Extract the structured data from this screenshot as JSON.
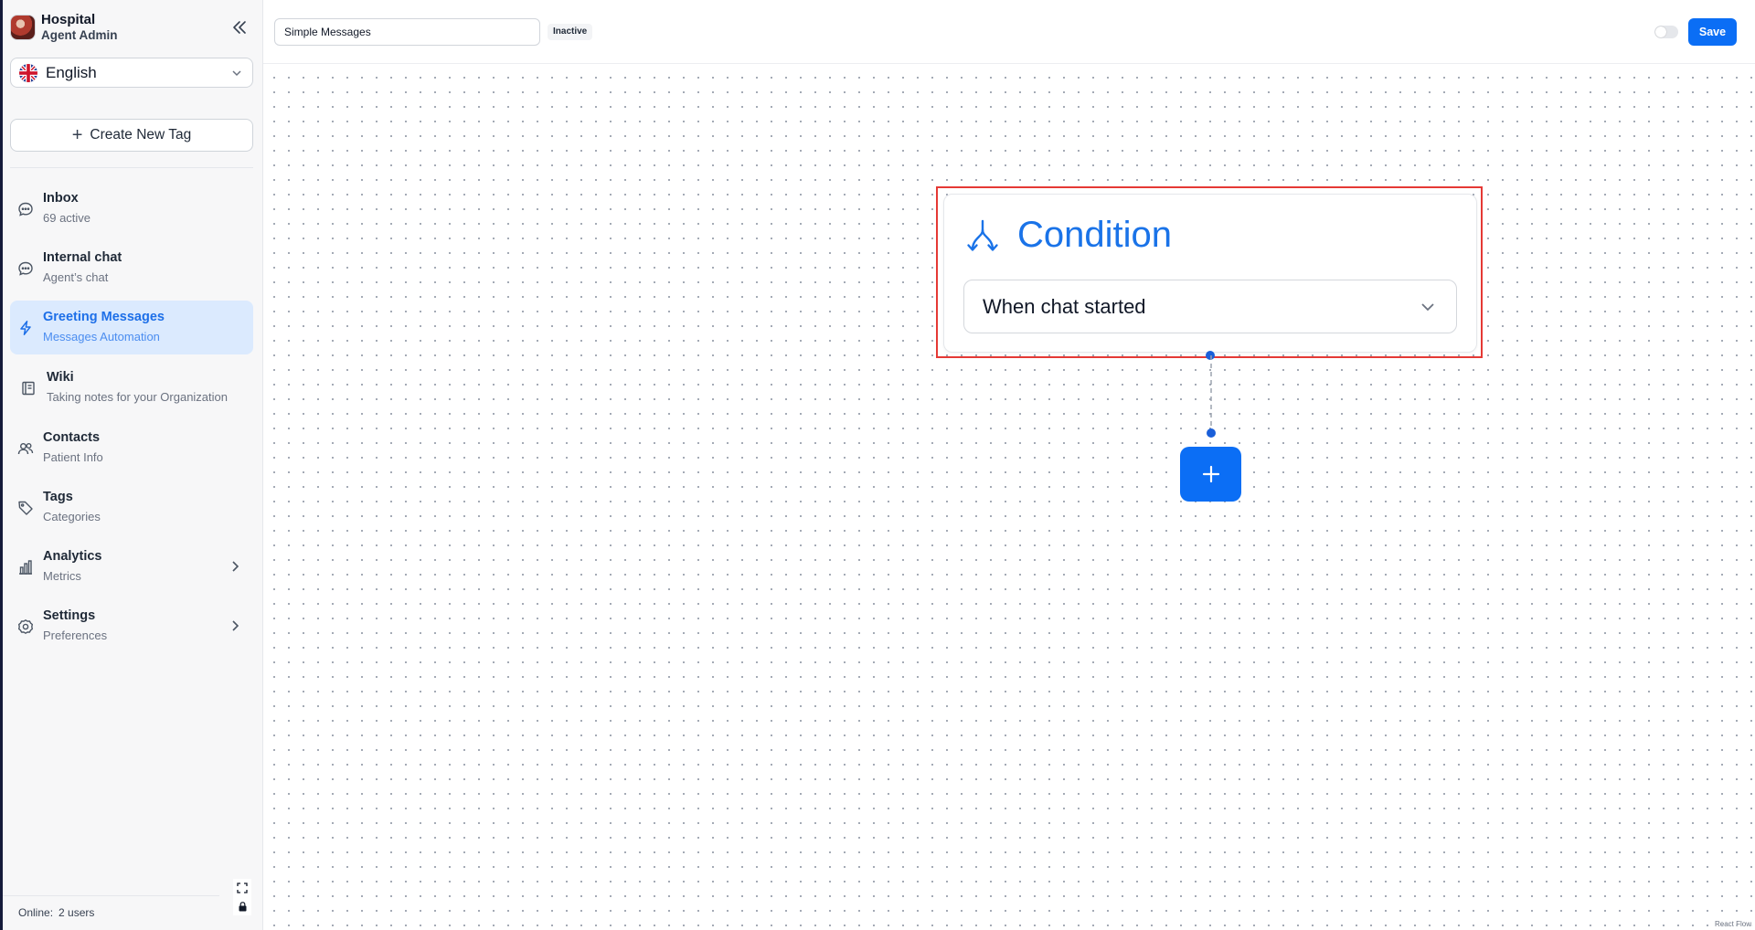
{
  "sidebar": {
    "brand_title": "Hospital",
    "brand_subtitle": "Agent Admin",
    "language": "English",
    "create_tag_label": "Create New Tag",
    "items": [
      {
        "title": "Inbox",
        "subtitle": "69 active",
        "icon": "chat-bubble-icon"
      },
      {
        "title": "Internal chat",
        "subtitle": "Agent’s chat",
        "icon": "chat-bubble-icon"
      },
      {
        "title": "Greeting Messages",
        "subtitle": "Messages Automation",
        "icon": "lightning-icon",
        "active": true
      },
      {
        "title": "Wiki",
        "subtitle": "Taking notes for your Organization",
        "icon": "book-icon"
      },
      {
        "title": "Contacts",
        "subtitle": "Patient Info",
        "icon": "users-icon"
      },
      {
        "title": "Tags",
        "subtitle": "Categories",
        "icon": "tag-icon"
      },
      {
        "title": "Analytics",
        "subtitle": "Metrics",
        "icon": "bar-chart-icon",
        "expandable": true
      },
      {
        "title": "Settings",
        "subtitle": "Preferences",
        "icon": "gear-icon",
        "expandable": true
      }
    ],
    "online_label": "Online:",
    "online_count": "2 users"
  },
  "topbar": {
    "flow_name": "Simple Messages",
    "status": "Inactive",
    "save_label": "Save",
    "active_toggle": false
  },
  "canvas": {
    "node": {
      "title": "Condition",
      "selected_condition": "When chat started",
      "icon": "split-arrows-icon"
    },
    "add_step_icon": "plus-icon",
    "attribution": "React Flow"
  },
  "colors": {
    "accent": "#0b6ef5",
    "active_nav_bg": "#dbeafe",
    "highlight_outline": "#e53935"
  }
}
